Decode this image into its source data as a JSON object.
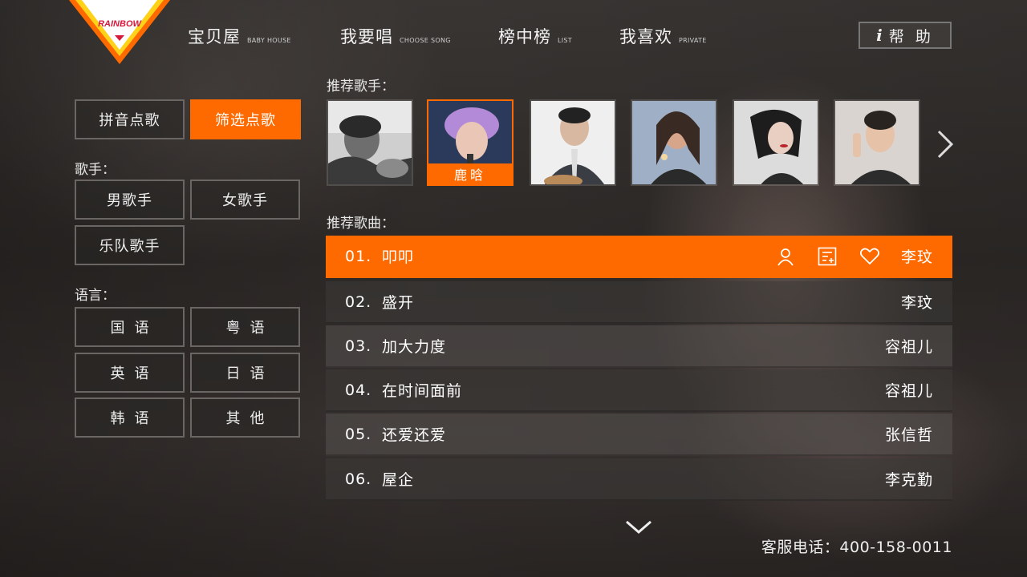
{
  "logo": {
    "text": "RAINBOW"
  },
  "nav": [
    {
      "cn": "宝贝屋",
      "en": "BABY HOUSE"
    },
    {
      "cn": "我要唱",
      "en": "CHOOSE SONG"
    },
    {
      "cn": "榜中榜",
      "en": "LIST"
    },
    {
      "cn": "我喜欢",
      "en": "PRIVATE"
    }
  ],
  "help": {
    "label": "帮 助"
  },
  "mode": {
    "pinyin": "拼音点歌",
    "filter": "筛选点歌"
  },
  "singer_filter": {
    "label": "歌手：",
    "male": "男歌手",
    "female": "女歌手",
    "band": "乐队歌手"
  },
  "language_filter": {
    "label": "语言：",
    "mandarin": "国语",
    "cantonese": "粤语",
    "english": "英语",
    "japanese": "日语",
    "korean": "韩语",
    "other": "其他"
  },
  "recommended_singers": {
    "title": "推荐歌手：",
    "selected_name": "鹿晗"
  },
  "recommended_songs": {
    "title": "推荐歌曲：",
    "songs": [
      {
        "num": "01.",
        "title": "叩叩",
        "artist": "李玟"
      },
      {
        "num": "02.",
        "title": "盛开",
        "artist": "李玟"
      },
      {
        "num": "03.",
        "title": "加大力度",
        "artist": "容祖儿"
      },
      {
        "num": "04.",
        "title": "在时间面前",
        "artist": "容祖儿"
      },
      {
        "num": "05.",
        "title": "还爱还爱",
        "artist": "张信哲"
      },
      {
        "num": "06.",
        "title": "屋企",
        "artist": "李克勤"
      }
    ]
  },
  "footer": {
    "hotline": "客服电话：400-158-0011"
  },
  "colors": {
    "accent": "#ff6a00"
  }
}
